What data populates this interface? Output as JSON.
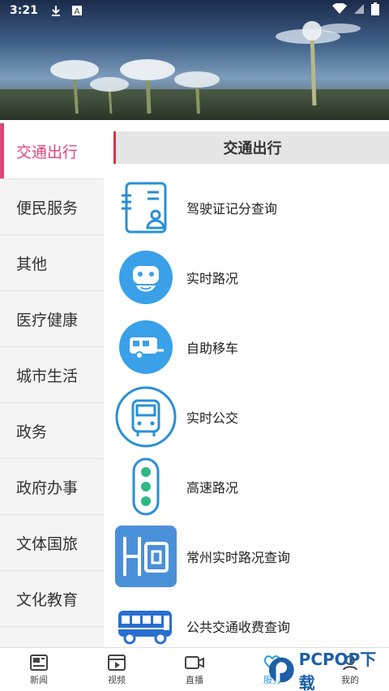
{
  "status_bar": {
    "time": "3:21",
    "icons": [
      "download-icon",
      "a-badge-icon",
      "wifi-icon",
      "signal-icon",
      "battery-icon"
    ]
  },
  "sidebar": {
    "active_color": "#e0457b",
    "items": [
      {
        "label": "交通出行",
        "active": true
      },
      {
        "label": "便民服务",
        "active": false
      },
      {
        "label": "其他",
        "active": false
      },
      {
        "label": "医疗健康",
        "active": false
      },
      {
        "label": "城市生活",
        "active": false
      },
      {
        "label": "政务",
        "active": false
      },
      {
        "label": "政府办事",
        "active": false
      },
      {
        "label": "文体国旅",
        "active": false
      },
      {
        "label": "文化教育",
        "active": false
      }
    ]
  },
  "content": {
    "section_title": "交通出行",
    "services": [
      {
        "label": "驾驶证记分查询",
        "icon": "driver-license-icon"
      },
      {
        "label": "实时路况",
        "icon": "robot-face-icon"
      },
      {
        "label": "自助移车",
        "icon": "trailer-icon"
      },
      {
        "label": "实时公交",
        "icon": "bus-front-icon"
      },
      {
        "label": "高速路况",
        "icon": "traffic-light-icon"
      },
      {
        "label": "常州实时路况查询",
        "icon": "road-map-icon"
      },
      {
        "label": "公共交通收费查询",
        "icon": "bus-side-icon"
      }
    ]
  },
  "bottom_nav": {
    "active_color": "#2a9cdc",
    "items": [
      {
        "label": "新闻",
        "icon": "news-icon",
        "active": false
      },
      {
        "label": "视频",
        "icon": "video-icon",
        "active": false
      },
      {
        "label": "直播",
        "icon": "live-camera-icon",
        "active": false
      },
      {
        "label": "服务",
        "icon": "heart-hands-icon",
        "active": true
      },
      {
        "label": "我的",
        "icon": "profile-icon",
        "active": false
      }
    ]
  },
  "watermark": {
    "text": "PCPOP下载"
  }
}
